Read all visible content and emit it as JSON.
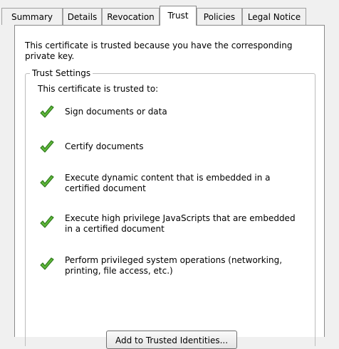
{
  "tabs": [
    {
      "label": "Summary",
      "active": false
    },
    {
      "label": "Details",
      "active": false
    },
    {
      "label": "Revocation",
      "active": false
    },
    {
      "label": "Trust",
      "active": true
    },
    {
      "label": "Policies",
      "active": false
    },
    {
      "label": "Legal Notice",
      "active": false
    }
  ],
  "trust": {
    "intro": "This certificate is trusted because you have the corresponding private key.",
    "group_title": "Trust Settings",
    "trusted_to_label": "This certificate is trusted to:",
    "items": [
      {
        "label": "Sign documents or data",
        "icon": "check-icon"
      },
      {
        "label": "Certify documents",
        "icon": "check-icon"
      },
      {
        "label": "Execute dynamic content that is embedded in a certified document",
        "icon": "check-icon"
      },
      {
        "label": "Execute high privilege JavaScripts that are embedded in a certified document",
        "icon": "check-icon"
      },
      {
        "label": "Perform privileged system operations (networking, printing, file access, etc.)",
        "icon": "check-icon"
      }
    ],
    "add_button_label": "Add to Trusted Identities..."
  },
  "colors": {
    "check_green": "#5fb83a",
    "check_dark": "#2f7a1c"
  }
}
